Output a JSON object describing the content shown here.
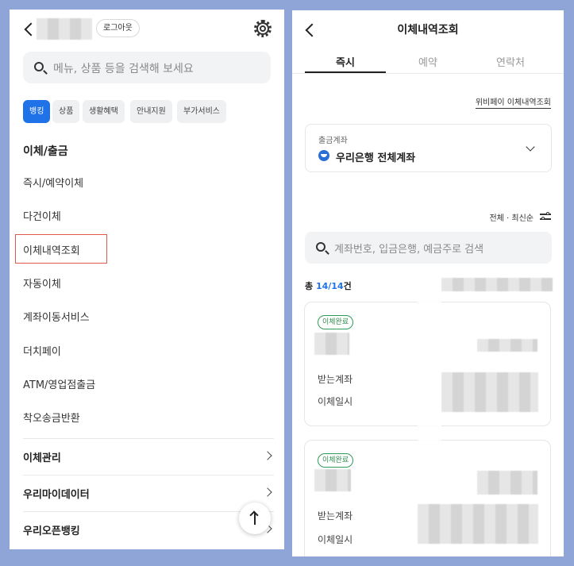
{
  "left": {
    "logout_label": "로그아웃",
    "search_placeholder": "메뉴, 상품 등을 검색해 보세요",
    "chips": [
      "뱅킹",
      "상품",
      "생활혜택",
      "안내지원",
      "부가서비스"
    ],
    "section_title": "이체/출금",
    "menu_items": [
      "즉시/예약이체",
      "다건이체",
      "이체내역조회",
      "자동이체",
      "계좌이동서비스",
      "더치페이",
      "ATM/영업점출금",
      "착오송금반환"
    ],
    "groups": [
      "이체관리",
      "우리마이데이터",
      "우리오픈뱅킹"
    ]
  },
  "right": {
    "title": "이체내역조회",
    "tabs": [
      "즉시",
      "예약",
      "연락처"
    ],
    "wibee_link": "위비페이 이체내역조회",
    "account_label": "출금계좌",
    "account_name": "우리은행 전체계좌",
    "sort_label": "전체 · 최신순",
    "search_placeholder": "계좌번호, 입금은행, 예금주로 검색",
    "count_prefix": "총 ",
    "count_value": "14/14",
    "count_suffix": "건",
    "cards": [
      {
        "badge": "이체완료",
        "field1": "받는계좌",
        "field2": "이체일시"
      },
      {
        "badge": "이체완료",
        "field1": "받는계좌",
        "field2": "이체일시"
      }
    ]
  },
  "colors": {
    "accent": "#1f72e8",
    "highlight_border": "#e05a4b",
    "badge_green": "#2f8a4f",
    "background": "#8fa5d8"
  }
}
